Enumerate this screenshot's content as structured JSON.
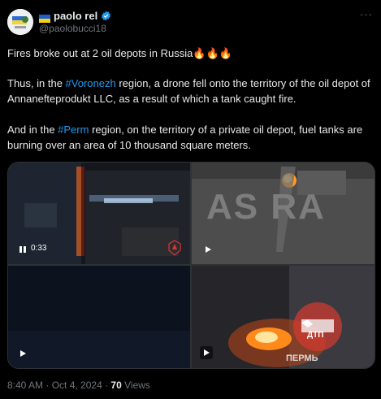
{
  "author": {
    "display_name": "paolo rel",
    "handle": "@paolobucci18",
    "flag_icon": "ukraine-flag",
    "verified_icon": "verified-badge",
    "verified_color": "#1d9bf0"
  },
  "more_label": "···",
  "tweet": {
    "line1": "Fires broke out at 2 oil depots in Russia",
    "line1_emoji": "🔥🔥🔥",
    "p2_before": "Thus, in the ",
    "p2_tag": "#Voronezh",
    "p2_after": " region, a drone fell onto the territory of the oil depot of Annanefteprodukt LLC, as a result of which a tank caught fire.",
    "p3_before": "And in the ",
    "p3_tag": "#Perm",
    "p3_after": " region, on the territory of a private oil depot, fuel tanks are burning over an area of 10 thousand square meters."
  },
  "media": {
    "duration": "0:33",
    "watermark_astra": "AS RA",
    "watermark_perm": "ПЕРМЬ",
    "watermark_dtp": "ДТП"
  },
  "meta": {
    "time": "8:40 AM",
    "separator": " · ",
    "date": "Oct 4, 2024",
    "views_count": "70",
    "views_label": " Views"
  },
  "colors": {
    "accent": "#1d9bf0",
    "muted": "#71767b",
    "text": "#e7e9ea",
    "background": "#000000"
  }
}
